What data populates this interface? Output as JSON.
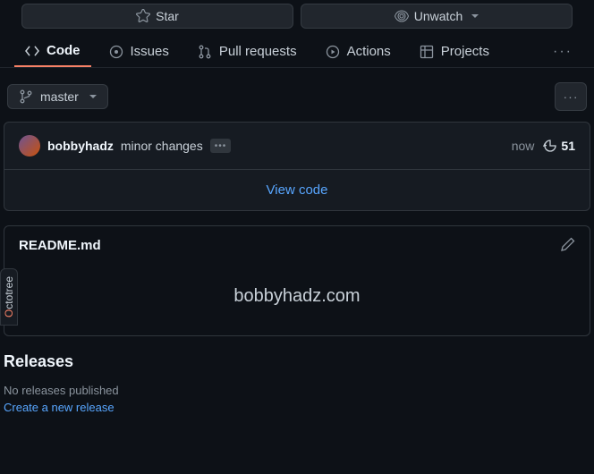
{
  "topActions": {
    "star": "Star",
    "unwatch": "Unwatch"
  },
  "tabs": {
    "code": "Code",
    "issues": "Issues",
    "pulls": "Pull requests",
    "actions": "Actions",
    "projects": "Projects",
    "more": "···"
  },
  "branch": {
    "name": "master",
    "kebab": "···"
  },
  "commit": {
    "author": "bobbyhadz",
    "message": "minor changes",
    "ellipsis": "•••",
    "time": "now",
    "count": "51"
  },
  "viewCode": "View code",
  "readme": {
    "filename": "README.md",
    "heading": "bobbyhadz.com"
  },
  "releases": {
    "title": "Releases",
    "none": "No releases published",
    "createLink": "Create a new release"
  },
  "octotree": {
    "o": "O",
    "rest": "ctotree"
  }
}
